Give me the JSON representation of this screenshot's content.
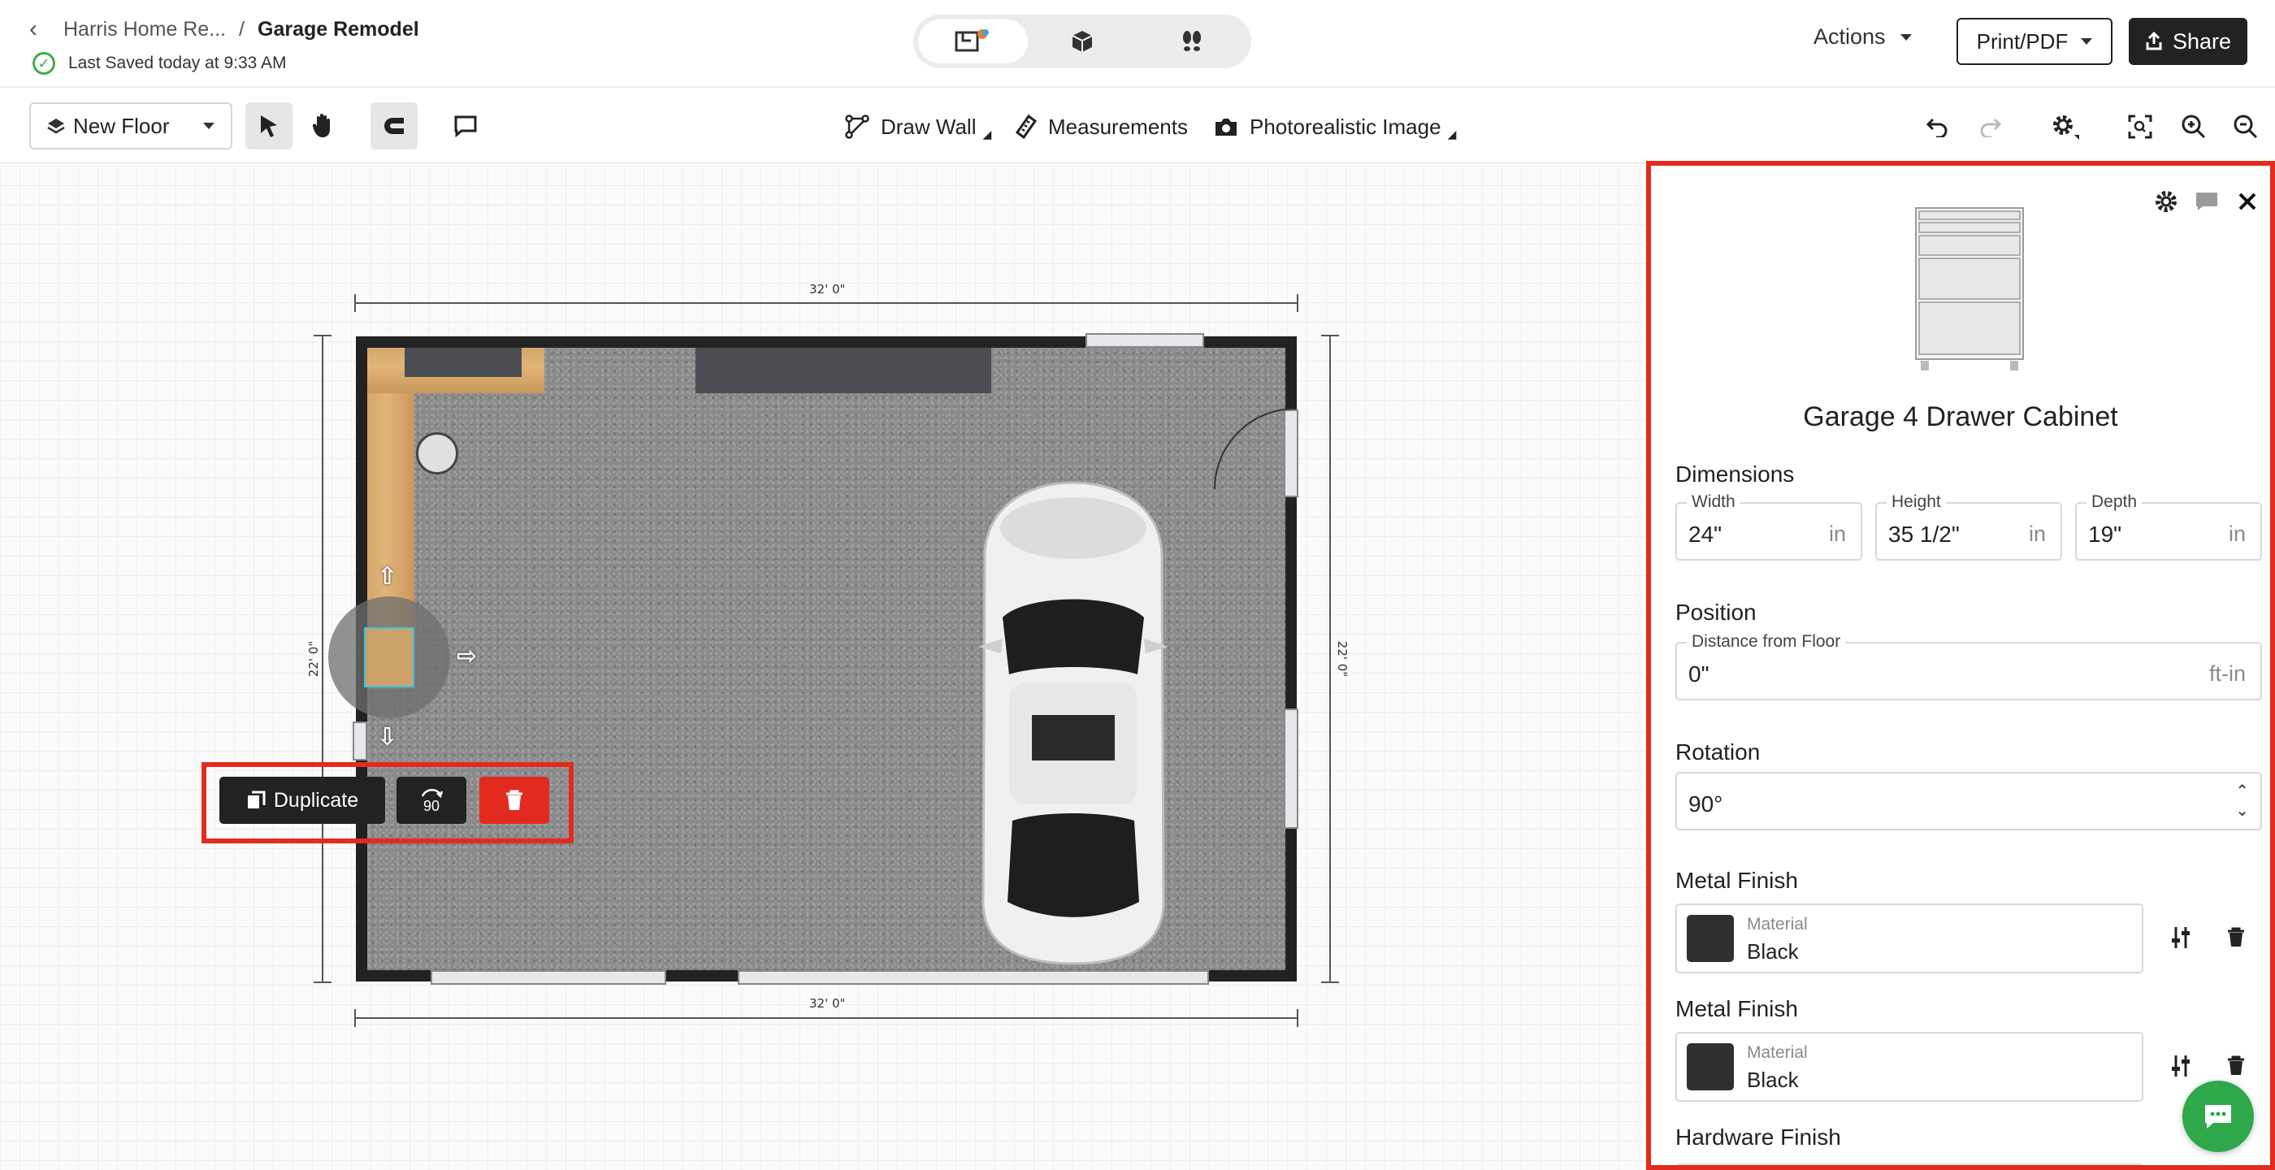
{
  "header": {
    "back_icon": "chevron-left-icon",
    "breadcrumb_parent": "Harris Home Re...",
    "breadcrumb_sep": "/",
    "breadcrumb_current": "Garage Remodel",
    "saved_status": "Last Saved today at 9:33 AM",
    "view_modes": [
      "2d-plan-icon",
      "3d-box-icon",
      "walkthrough-footprints-icon"
    ],
    "actions_label": "Actions",
    "print_label": "Print/PDF",
    "share_label": "Share"
  },
  "toolbar": {
    "floor_label": "New Floor",
    "draw_wall_label": "Draw Wall",
    "measurements_label": "Measurements",
    "photo_label": "Photorealistic Image"
  },
  "canvas": {
    "top_dimension": "32' 0\"",
    "bottom_dimension": "32' 0\"",
    "left_dimension": "22' 0\"",
    "right_dimension": "22' 0\"",
    "duplicate_label": "Duplicate",
    "rotate_label": "90"
  },
  "panel": {
    "title": "Garage 4 Drawer Cabinet",
    "dimensions_heading": "Dimensions",
    "width": {
      "label": "Width",
      "value": "24\"",
      "unit": "in"
    },
    "height": {
      "label": "Height",
      "value": "35 1/2\"",
      "unit": "in"
    },
    "depth": {
      "label": "Depth",
      "value": "19\"",
      "unit": "in"
    },
    "position_heading": "Position",
    "distance": {
      "label": "Distance from Floor",
      "value": "0\"",
      "unit": "ft-in"
    },
    "rotation_heading": "Rotation",
    "rotation_value": "90°",
    "finishes": [
      {
        "heading": "Metal Finish",
        "label": "Material",
        "value": "Black",
        "color": "#303030"
      },
      {
        "heading": "Metal Finish",
        "label": "Material",
        "value": "Black",
        "color": "#303030"
      }
    ],
    "hardware_heading": "Hardware Finish"
  },
  "colors": {
    "highlight": "#e22b1e",
    "chat": "#2ea84a",
    "saved": "#3fae48"
  }
}
